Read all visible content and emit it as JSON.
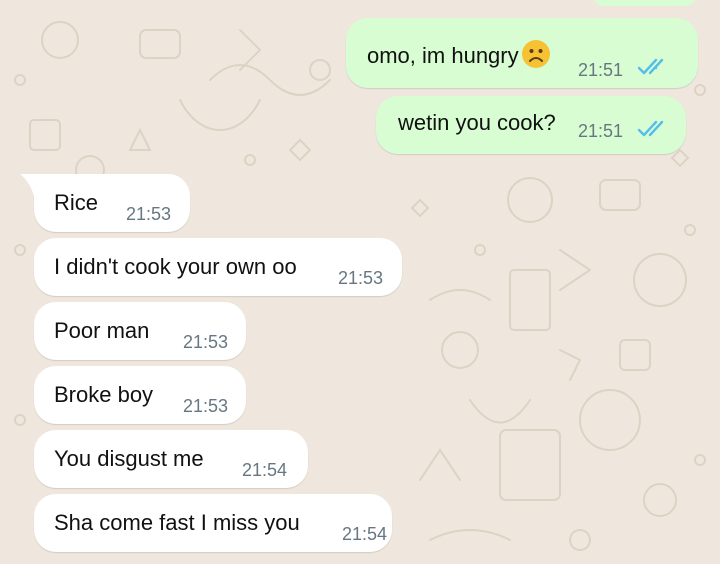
{
  "colors": {
    "wallpaper": "#efe7dd",
    "outgoing_bubble": "#d9fdd3",
    "incoming_bubble": "#ffffff",
    "timestamp": "#667781",
    "read_ticks": "#53bdeb"
  },
  "messages": {
    "out": [
      {
        "text": "omo, im hungry",
        "emoji": "slightly-frowning-face",
        "time": "21:51",
        "status": "read"
      },
      {
        "text": "wetin you cook?",
        "time": "21:51",
        "status": "read"
      }
    ],
    "in": [
      {
        "text": "Rice",
        "time": "21:53"
      },
      {
        "text": "I didn't cook your own oo",
        "time": "21:53"
      },
      {
        "text": "Poor man",
        "time": "21:53"
      },
      {
        "text": "Broke boy",
        "time": "21:53"
      },
      {
        "text": "You disgust me",
        "time": "21:54"
      },
      {
        "text": "Sha come fast I miss you",
        "time": "21:54"
      }
    ]
  }
}
